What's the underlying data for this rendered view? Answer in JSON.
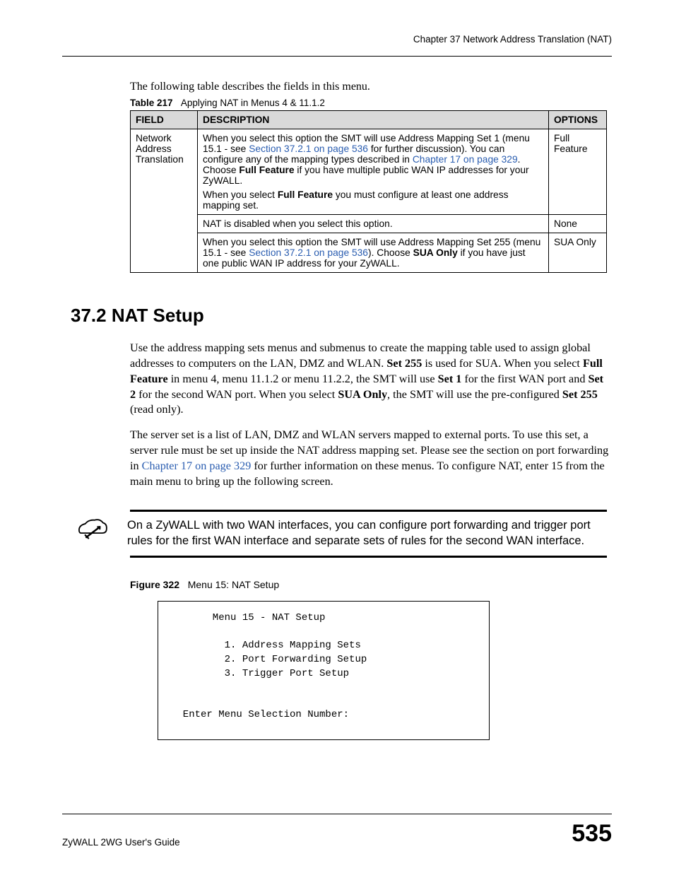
{
  "header": {
    "chapter": "Chapter 37 Network Address Translation (NAT)"
  },
  "intro": "The following table describes the fields in this menu.",
  "table217": {
    "label": "Table 217",
    "caption": "Applying NAT in Menus 4 & 11.1.2",
    "columns": {
      "field": "FIELD",
      "description": "DESCRIPTION",
      "options": "OPTIONS"
    },
    "row1": {
      "field": "Network Address Translation",
      "desc_p1_pre": "When you select this option the SMT will use Address Mapping Set 1 (menu 15.1 - see ",
      "desc_p1_link1": "Section 37.2.1 on page 536",
      "desc_p1_mid": " for further discussion). You can configure any of the mapping types described in ",
      "desc_p1_link2": "Chapter 17 on page 329",
      "desc_p1_post_a": ". Choose ",
      "desc_p1_bold": "Full Feature",
      "desc_p1_post_b": " if you have multiple public WAN IP addresses for your ZyWALL.",
      "desc_p2_pre": "When you select ",
      "desc_p2_bold": "Full Feature",
      "desc_p2_post": " you must configure at least one address mapping set.",
      "options": "Full Feature"
    },
    "row2": {
      "desc": "NAT is disabled when you select this option.",
      "options": "None"
    },
    "row3": {
      "desc_pre": "When you select this option the SMT will use Address Mapping Set 255 (menu 15.1 - see ",
      "desc_link": "Section 37.2.1 on page 536",
      "desc_mid": "). Choose ",
      "desc_bold": "SUA Only",
      "desc_post": " if you have just one public WAN IP address for your ZyWALL.",
      "options": "SUA Only"
    }
  },
  "sectionHeading": "37.2  NAT Setup",
  "para1": {
    "t1": "Use the address mapping sets menus and submenus to create the mapping table used to assign global addresses to computers on the LAN, DMZ and WLAN. ",
    "b1": "Set 255",
    "t2": " is used for SUA. When you select ",
    "b2": "Full Feature",
    "t3": " in menu 4, menu 11.1.2 or menu 11.2.2, the SMT will use ",
    "b3": "Set 1",
    "t4": " for the first WAN port and ",
    "b4": "Set 2",
    "t5": " for the second WAN port. When you select ",
    "b5": "SUA Only",
    "t6": ", the SMT will use the pre-configured ",
    "b6": "Set 255",
    "t7": " (read only)."
  },
  "para2": {
    "t1": "The server set is a list of LAN, DMZ and WLAN servers mapped to external ports. To use this set, a server rule must be set up inside the NAT address mapping set. Please see the section on port forwarding in ",
    "link": "Chapter 17 on page 329",
    "t2": " for further information on these menus. To configure NAT, enter 15 from the main menu to bring up the following screen."
  },
  "note": {
    "text": "On a ZyWALL with two WAN interfaces, you can configure port forwarding and trigger port rules for the first WAN interface and separate sets of rules for the second WAN interface."
  },
  "figure322": {
    "label": "Figure 322",
    "caption": "Menu 15: NAT Setup",
    "content": "       Menu 15 - NAT Setup\n\n         1. Address Mapping Sets\n         2. Port Forwarding Setup\n         3. Trigger Port Setup\n\n\n  Enter Menu Selection Number:"
  },
  "footer": {
    "guide": "ZyWALL 2WG User's Guide",
    "page": "535"
  }
}
